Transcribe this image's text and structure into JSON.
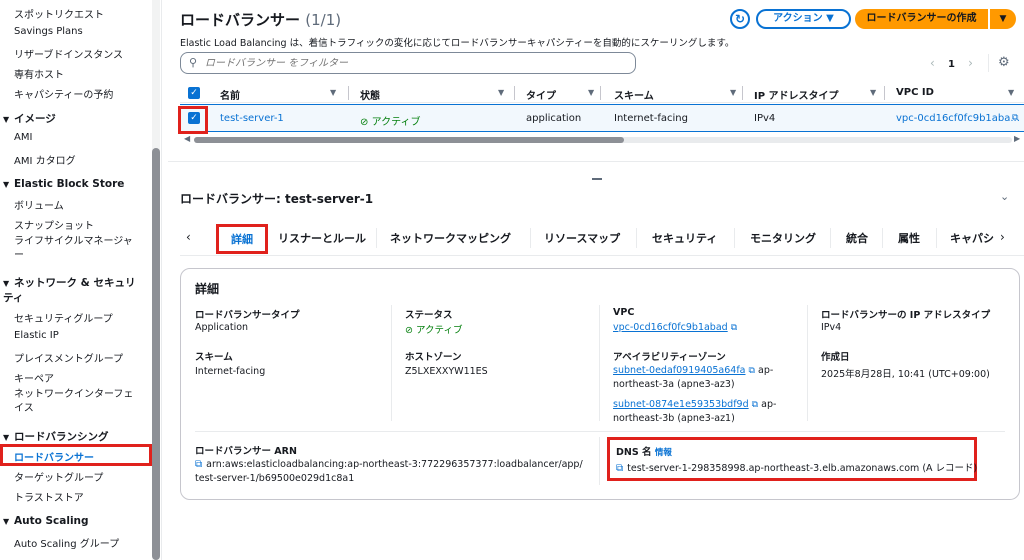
{
  "sidebar": {
    "items_top": [
      {
        "label": "スポットリクエスト"
      },
      {
        "label": "Savings Plans"
      },
      {
        "label": "リザーブドインスタンス"
      },
      {
        "label": "専有ホスト"
      },
      {
        "label": "キャパシティーの予約"
      }
    ],
    "section_images": "イメージ",
    "images_items": [
      {
        "label": "AMI"
      },
      {
        "label": "AMI カタログ"
      }
    ],
    "section_ebs": "Elastic Block Store",
    "ebs_items": [
      {
        "label": "ボリューム"
      },
      {
        "label": "スナップショット"
      },
      {
        "label": "ライフサイクルマネージャー"
      }
    ],
    "section_network": "ネットワーク & セキュリティ",
    "network_items": [
      {
        "label": "セキュリティグループ"
      },
      {
        "label": "Elastic IP"
      },
      {
        "label": "プレイスメントグループ"
      },
      {
        "label": "キーペア"
      },
      {
        "label": "ネットワークインターフェイス"
      }
    ],
    "section_lb": "ロードバランシング",
    "lb_items": [
      {
        "label": "ロードバランサー"
      },
      {
        "label": "ターゲットグループ"
      },
      {
        "label": "トラストストア"
      }
    ],
    "section_as": "Auto Scaling",
    "as_items": [
      {
        "label": "Auto Scaling グループ"
      }
    ]
  },
  "header": {
    "title": "ロードバランサー",
    "count": "(1/1)",
    "description": "Elastic Load Balancing は、着信トラフィックの変化に応じてロードバランサーキャパシティーを自動的にスケーリングします。",
    "action_label": "アクション ▼",
    "create_label": "ロードバランサーの作成",
    "filter_placeholder": "ロードバランサー をフィルター",
    "page": "1"
  },
  "table": {
    "columns": [
      "名前",
      "状態",
      "タイプ",
      "スキーム",
      "IP アドレスタイプ",
      "VPC ID"
    ],
    "rows": [
      {
        "name": "test-server-1",
        "state": "アクティブ",
        "type": "application",
        "scheme": "Internet-facing",
        "ip_type": "IPv4",
        "vpc": "vpc-0cd16cf0fc9b1aba..."
      }
    ]
  },
  "detail": {
    "title": "ロードバランサー: test-server-1",
    "tabs": [
      "詳細",
      "リスナーとルール",
      "ネットワークマッピング",
      "リソースマップ",
      "セキュリティ",
      "モニタリング",
      "統合",
      "属性",
      "キャパシ"
    ],
    "section_title": "詳細",
    "fields": {
      "lb_type_label": "ロードバランサータイプ",
      "lb_type_value": "Application",
      "scheme_label": "スキーム",
      "scheme_value": "Internet-facing",
      "status_label": "ステータス",
      "status_value": "アクティブ",
      "hosted_zone_label": "ホストゾーン",
      "hosted_zone_value": "Z5LXEXXYW11ES",
      "vpc_label": "VPC",
      "vpc_value": "vpc-0cd16cf0fc9b1abad",
      "az_label": "アベイラビリティーゾーン",
      "az1_link": "subnet-0edaf0919405a64fa",
      "az1_suffix": "ap-northeast-3a (apne3-az3)",
      "az2_link": "subnet-0874e1e59353bdf9d",
      "az2_suffix": "ap-northeast-3b (apne3-az1)",
      "ip_type_label": "ロードバランサーの IP アドレスタイプ",
      "ip_type_value": "IPv4",
      "created_label": "作成日",
      "created_value": "2025年8月28日, 10:41 (UTC+09:00)",
      "arn_label": "ロードバランサー ARN",
      "arn_value": "arn:aws:elasticloadbalancing:ap-northeast-3:772296357377:loadbalancer/app/test-server-1/b69500e029d1c8a1",
      "dns_label": "DNS 名",
      "dns_info": "情報",
      "dns_value": "test-server-1-298358998.ap-northeast-3.elb.amazonaws.com (A レコード)"
    }
  },
  "colors": {
    "accent": "#0972d3",
    "primary": "#ff9900",
    "success": "#037f0c",
    "highlight": "#e0211c"
  }
}
